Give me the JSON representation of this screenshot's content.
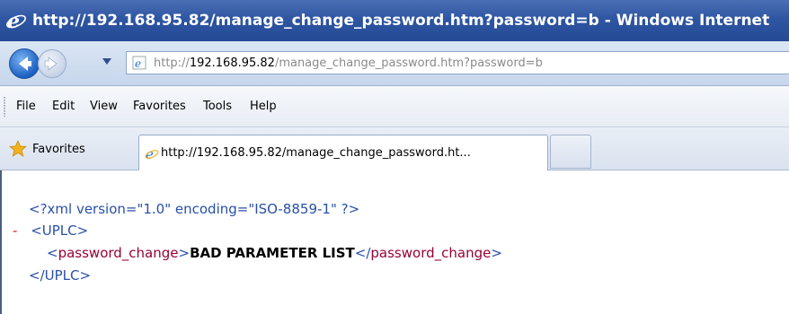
{
  "window": {
    "title": "http://192.168.95.82/manage_change_password.htm?password=b - Windows Internet"
  },
  "navigation": {
    "address_prefix": "http://",
    "address_host": "192.168.95.82",
    "address_path": "/manage_change_password.htm?password=b"
  },
  "menu": {
    "items": [
      "File",
      "Edit",
      "View",
      "Favorites",
      "Tools",
      "Help"
    ]
  },
  "favorites_bar": {
    "favorites_label": "Favorites"
  },
  "tabs": [
    {
      "label": "http://192.168.95.82/manage_change_password.ht..."
    }
  ],
  "content": {
    "xml_declaration": "<?xml version=\"1.0\" encoding=\"ISO-8859-1\" ?>",
    "collapse_marker": "-",
    "root_open": "<UPLC>",
    "child_open_tag": "password_change",
    "child_text": "BAD PARAMETER LIST",
    "child_close_tag": "password_change",
    "root_close": "</UPLC>"
  },
  "colors": {
    "titlebar": "#2f56a2",
    "xml_markup": "#2850a8",
    "xml_tag_name": "#990033",
    "collapse_marker": "#d02020"
  },
  "icons": {
    "window": "ie-logo-icon",
    "back": "back-arrow-icon",
    "forward": "forward-arrow-icon",
    "page": "ie-page-icon",
    "favorites": "star-icon"
  }
}
